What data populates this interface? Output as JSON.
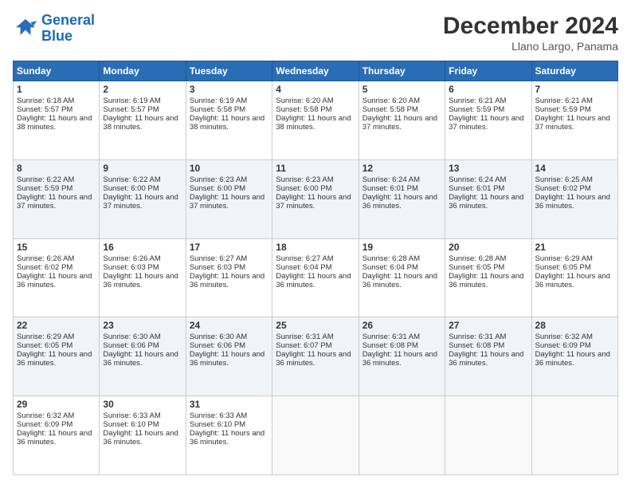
{
  "header": {
    "logo_line1": "General",
    "logo_line2": "Blue",
    "title": "December 2024",
    "subtitle": "Llano Largo, Panama"
  },
  "weekdays": [
    "Sunday",
    "Monday",
    "Tuesday",
    "Wednesday",
    "Thursday",
    "Friday",
    "Saturday"
  ],
  "weeks": [
    [
      {
        "day": "1",
        "sunrise": "6:18 AM",
        "sunset": "5:57 PM",
        "daylight": "11 hours and 38 minutes."
      },
      {
        "day": "2",
        "sunrise": "6:19 AM",
        "sunset": "5:57 PM",
        "daylight": "11 hours and 38 minutes."
      },
      {
        "day": "3",
        "sunrise": "6:19 AM",
        "sunset": "5:58 PM",
        "daylight": "11 hours and 38 minutes."
      },
      {
        "day": "4",
        "sunrise": "6:20 AM",
        "sunset": "5:58 PM",
        "daylight": "11 hours and 38 minutes."
      },
      {
        "day": "5",
        "sunrise": "6:20 AM",
        "sunset": "5:58 PM",
        "daylight": "11 hours and 37 minutes."
      },
      {
        "day": "6",
        "sunrise": "6:21 AM",
        "sunset": "5:59 PM",
        "daylight": "11 hours and 37 minutes."
      },
      {
        "day": "7",
        "sunrise": "6:21 AM",
        "sunset": "5:59 PM",
        "daylight": "11 hours and 37 minutes."
      }
    ],
    [
      {
        "day": "8",
        "sunrise": "6:22 AM",
        "sunset": "5:59 PM",
        "daylight": "11 hours and 37 minutes."
      },
      {
        "day": "9",
        "sunrise": "6:22 AM",
        "sunset": "6:00 PM",
        "daylight": "11 hours and 37 minutes."
      },
      {
        "day": "10",
        "sunrise": "6:23 AM",
        "sunset": "6:00 PM",
        "daylight": "11 hours and 37 minutes."
      },
      {
        "day": "11",
        "sunrise": "6:23 AM",
        "sunset": "6:00 PM",
        "daylight": "11 hours and 37 minutes."
      },
      {
        "day": "12",
        "sunrise": "6:24 AM",
        "sunset": "6:01 PM",
        "daylight": "11 hours and 36 minutes."
      },
      {
        "day": "13",
        "sunrise": "6:24 AM",
        "sunset": "6:01 PM",
        "daylight": "11 hours and 36 minutes."
      },
      {
        "day": "14",
        "sunrise": "6:25 AM",
        "sunset": "6:02 PM",
        "daylight": "11 hours and 36 minutes."
      }
    ],
    [
      {
        "day": "15",
        "sunrise": "6:26 AM",
        "sunset": "6:02 PM",
        "daylight": "11 hours and 36 minutes."
      },
      {
        "day": "16",
        "sunrise": "6:26 AM",
        "sunset": "6:03 PM",
        "daylight": "11 hours and 36 minutes."
      },
      {
        "day": "17",
        "sunrise": "6:27 AM",
        "sunset": "6:03 PM",
        "daylight": "11 hours and 36 minutes."
      },
      {
        "day": "18",
        "sunrise": "6:27 AM",
        "sunset": "6:04 PM",
        "daylight": "11 hours and 36 minutes."
      },
      {
        "day": "19",
        "sunrise": "6:28 AM",
        "sunset": "6:04 PM",
        "daylight": "11 hours and 36 minutes."
      },
      {
        "day": "20",
        "sunrise": "6:28 AM",
        "sunset": "6:05 PM",
        "daylight": "11 hours and 36 minutes."
      },
      {
        "day": "21",
        "sunrise": "6:29 AM",
        "sunset": "6:05 PM",
        "daylight": "11 hours and 36 minutes."
      }
    ],
    [
      {
        "day": "22",
        "sunrise": "6:29 AM",
        "sunset": "6:05 PM",
        "daylight": "11 hours and 36 minutes."
      },
      {
        "day": "23",
        "sunrise": "6:30 AM",
        "sunset": "6:06 PM",
        "daylight": "11 hours and 36 minutes."
      },
      {
        "day": "24",
        "sunrise": "6:30 AM",
        "sunset": "6:06 PM",
        "daylight": "11 hours and 36 minutes."
      },
      {
        "day": "25",
        "sunrise": "6:31 AM",
        "sunset": "6:07 PM",
        "daylight": "11 hours and 36 minutes."
      },
      {
        "day": "26",
        "sunrise": "6:31 AM",
        "sunset": "6:08 PM",
        "daylight": "11 hours and 36 minutes."
      },
      {
        "day": "27",
        "sunrise": "6:31 AM",
        "sunset": "6:08 PM",
        "daylight": "11 hours and 36 minutes."
      },
      {
        "day": "28",
        "sunrise": "6:32 AM",
        "sunset": "6:09 PM",
        "daylight": "11 hours and 36 minutes."
      }
    ],
    [
      {
        "day": "29",
        "sunrise": "6:32 AM",
        "sunset": "6:09 PM",
        "daylight": "11 hours and 36 minutes."
      },
      {
        "day": "30",
        "sunrise": "6:33 AM",
        "sunset": "6:10 PM",
        "daylight": "11 hours and 36 minutes."
      },
      {
        "day": "31",
        "sunrise": "6:33 AM",
        "sunset": "6:10 PM",
        "daylight": "11 hours and 36 minutes."
      },
      null,
      null,
      null,
      null
    ]
  ]
}
